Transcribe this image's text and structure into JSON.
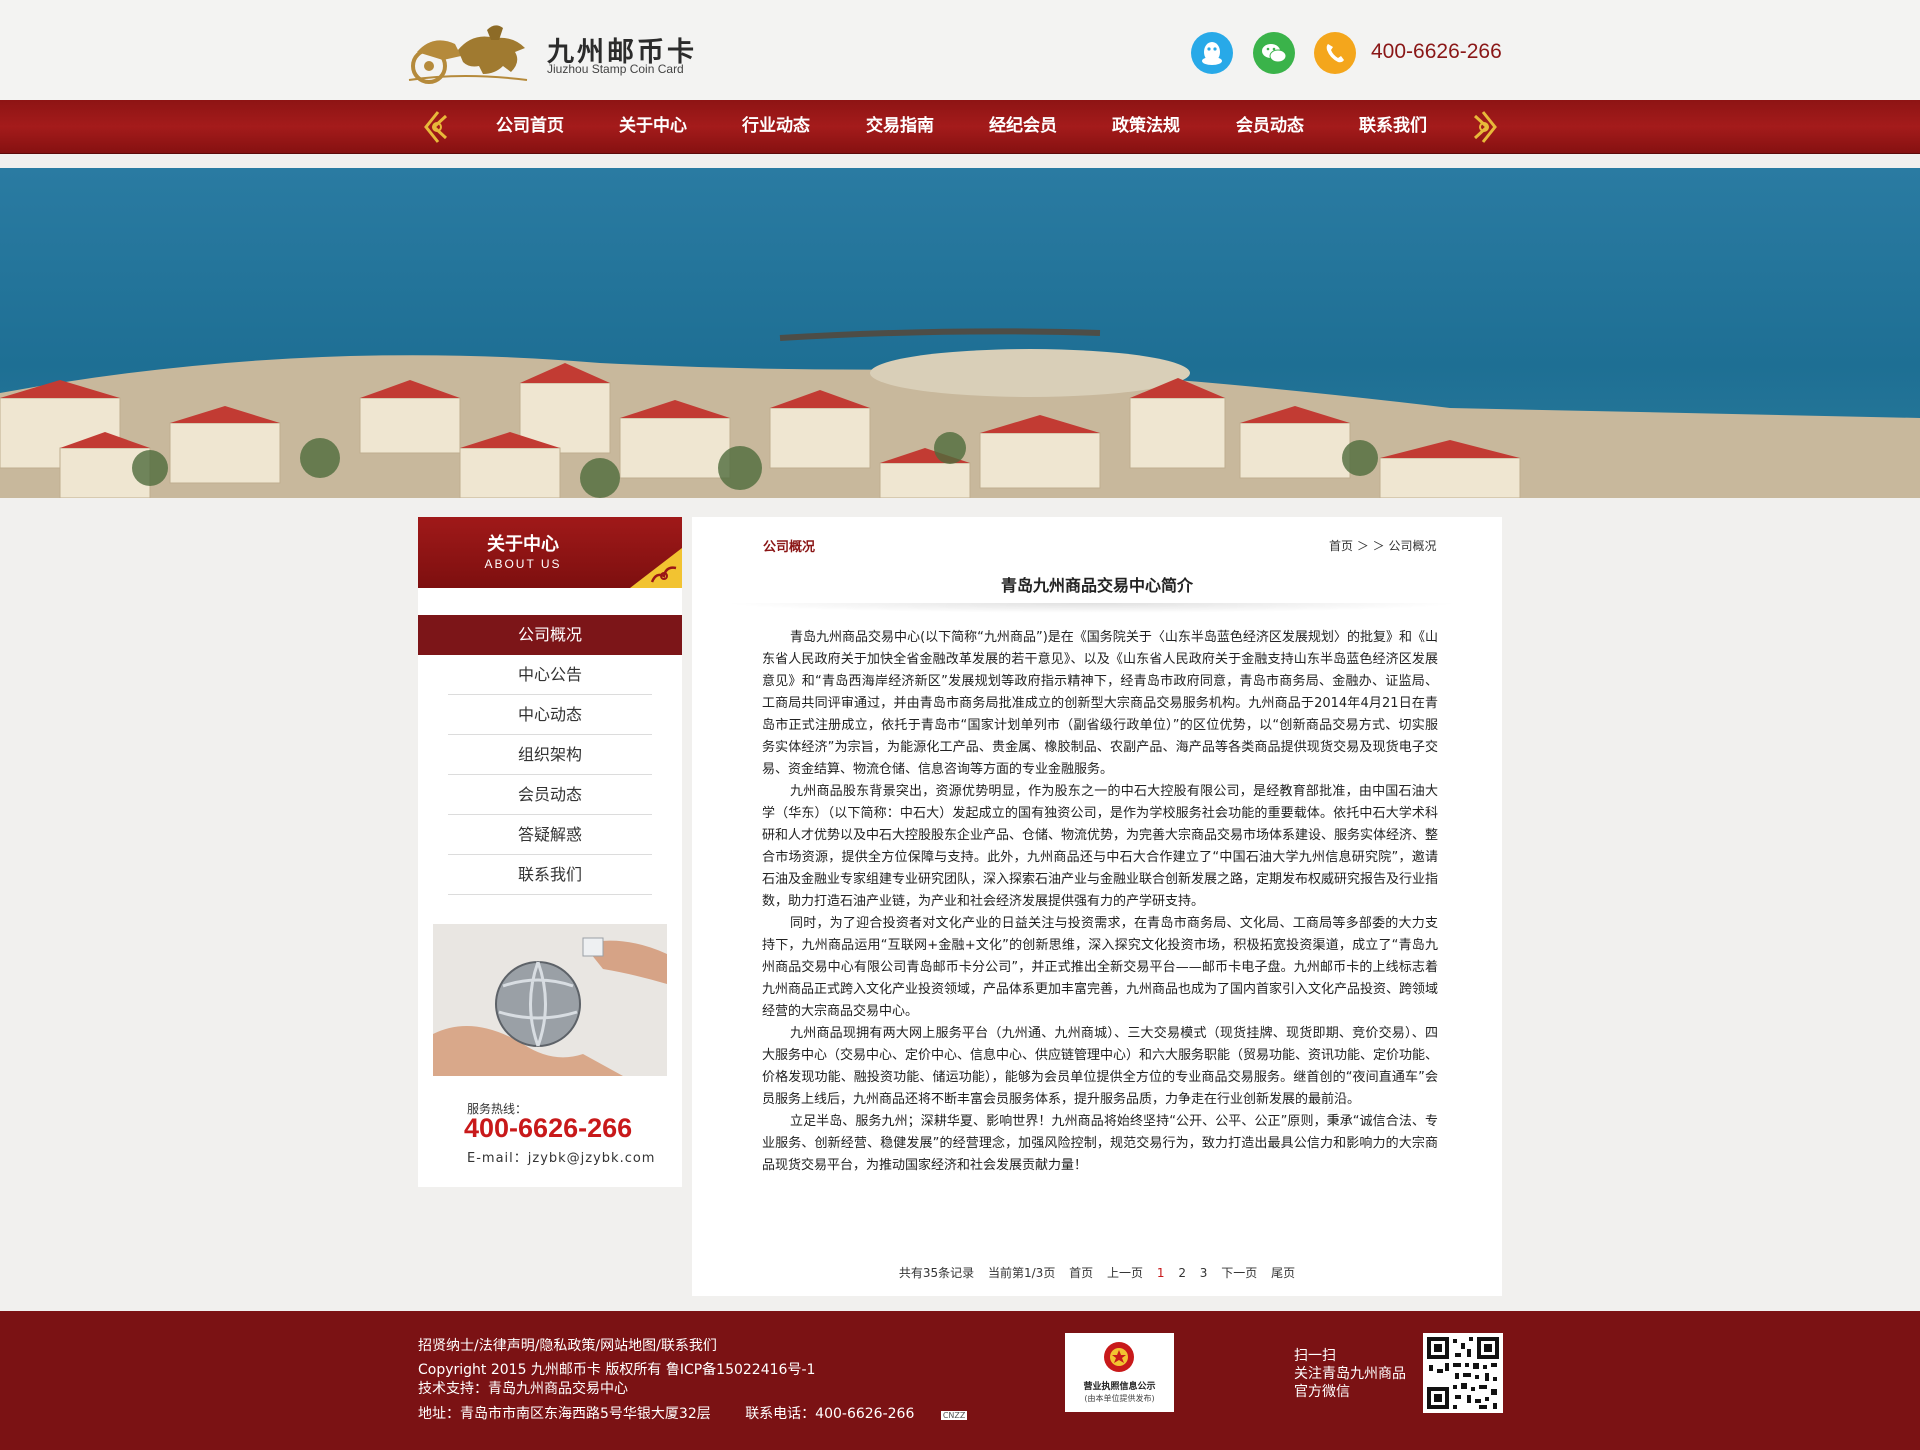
{
  "header": {
    "logo_cn": "九州邮币卡",
    "logo_en": "Jiuzhou Stamp Coin Card",
    "phone": "400-6626-266",
    "icons": [
      "qq-icon",
      "wechat-icon",
      "phone-icon"
    ]
  },
  "nav": {
    "items": [
      {
        "label": "公司首页"
      },
      {
        "label": "关于中心"
      },
      {
        "label": "行业动态"
      },
      {
        "label": "交易指南"
      },
      {
        "label": "经纪会员"
      },
      {
        "label": "政策法规"
      },
      {
        "label": "会员动态"
      },
      {
        "label": "联系我们"
      }
    ]
  },
  "sidebar": {
    "title": "关于中心",
    "subtitle": "ABOUT US",
    "items": [
      {
        "label": "公司概况",
        "active": true
      },
      {
        "label": "中心公告"
      },
      {
        "label": "中心动态"
      },
      {
        "label": "组织架构"
      },
      {
        "label": "会员动态"
      },
      {
        "label": "答疑解惑"
      },
      {
        "label": "联系我们"
      }
    ],
    "hotline_label": "服务热线：",
    "hotline": "400-6626-266",
    "email": "E-mail：jzybk@jzybk.com"
  },
  "main": {
    "section": "公司概况",
    "breadcrumb": "首页 ＞ ＞ 公司概况",
    "title": "青岛九州商品交易中心简介",
    "paragraphs": [
      "青岛九州商品交易中心(以下简称“九州商品”)是在《国务院关于〈山东半岛蓝色经济区发展规划〉的批复》和《山东省人民政府关于加快全省金融改革发展的若干意见》、以及《山东省人民政府关于金融支持山东半岛蓝色经济区发展意见》和“青岛西海岸经济新区”发展规划等政府指示精神下，经青岛市政府同意，青岛市商务局、金融办、证监局、工商局共同评审通过，并由青岛市商务局批准成立的创新型大宗商品交易服务机构。九州商品于2014年4月21日在青岛市正式注册成立，依托于青岛市“国家计划单列市（副省级行政单位）”的区位优势，以“创新商品交易方式、切实服务实体经济”为宗旨，为能源化工产品、贵金属、橡胶制品、农副产品、海产品等各类商品提供现货交易及现货电子交易、资金结算、物流仓储、信息咨询等方面的专业金融服务。",
      "九州商品股东背景突出，资源优势明显，作为股东之一的中石大控股有限公司，是经教育部批准，由中国石油大学（华东）（以下简称：中石大）发起成立的国有独资公司，是作为学校服务社会功能的重要载体。依托中石大学术科研和人才优势以及中石大控股股东企业产品、仓储、物流优势，为完善大宗商品交易市场体系建设、服务实体经济、整合市场资源，提供全方位保障与支持。此外，九州商品还与中石大合作建立了“中国石油大学九州信息研究院”，邀请石油及金融业专家组建专业研究团队，深入探索石油产业与金融业联合创新发展之路，定期发布权威研究报告及行业指数，助力打造石油产业链，为产业和社会经济发展提供强有力的产学研支持。",
      "同时，为了迎合投资者对文化产业的日益关注与投资需求，在青岛市商务局、文化局、工商局等多部委的大力支持下，九州商品运用“互联网+金融+文化”的创新思维，深入探究文化投资市场，积极拓宽投资渠道，成立了“青岛九州商品交易中心有限公司青岛邮币卡分公司”，并正式推出全新交易平台——邮币卡电子盘。九州邮币卡的上线标志着九州商品正式跨入文化产业投资领域，产品体系更加丰富完善，九州商品也成为了国内首家引入文化产品投资、跨领域经营的大宗商品交易中心。",
      "九州商品现拥有两大网上服务平台（九州通、九州商城）、三大交易模式（现货挂牌、现货即期、竞价交易）、四大服务中心（交易中心、定价中心、信息中心、供应链管理中心）和六大服务职能（贸易功能、资讯功能、定价功能、价格发现功能、融投资功能、储运功能），能够为会员单位提供全方位的专业商品交易服务。继首创的“夜间直通车”会员服务上线后，九州商品还将不断丰富会员服务体系，提升服务品质，力争走在行业创新发展的最前沿。",
      "立足半岛、服务九州；深耕华夏、影响世界！九州商品将始终坚持“公开、公平、公正”原则，秉承“诚信合法、专业服务、创新经营、稳健发展”的经营理念，加强风险控制，规范交易行为，致力打造出最具公信力和影响力的大宗商品现货交易平台，为推动国家经济和社会发展贡献力量！"
    ],
    "pager": {
      "total": "共有35条记录",
      "current": "当前第1/3页",
      "first": "首页",
      "prev": "上一页",
      "pages": [
        "1",
        "2",
        "3"
      ],
      "next": "下一页",
      "last": "尾页"
    }
  },
  "footer": {
    "links": "招贤纳士/法律声明/隐私政策/网站地图/联系我们",
    "copyright": "Copyright 2015 九州邮币卡 版权所有 鲁ICP备15022416号-1",
    "support": "技术支持：青岛九州商品交易中心",
    "address": "地址：青岛市市南区东海西路5号华银大厦32层",
    "tel": "联系电话：400-6626-266",
    "cnzz": "CNZZ",
    "badge_line1": "营业执照信息公示",
    "badge_line2": "(由本单位提供发布)",
    "scan_lines": [
      "扫一扫",
      "关注青岛九州商品",
      "官方微信"
    ]
  }
}
